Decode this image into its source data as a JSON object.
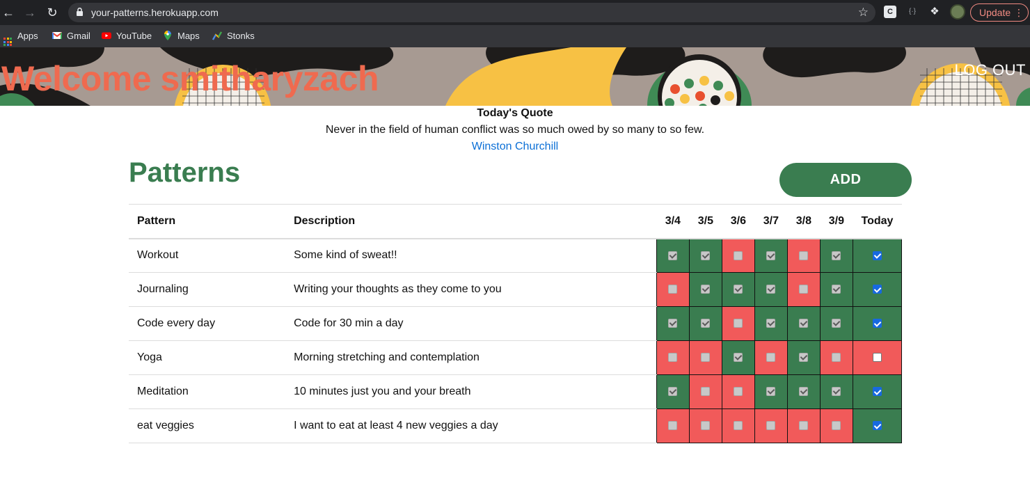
{
  "browser": {
    "url": "your-patterns.herokuapp.com",
    "update_label": "Update",
    "bookmarks": [
      {
        "label": "Apps",
        "icon": "apps-grid-icon"
      },
      {
        "label": "Gmail",
        "icon": "gmail-icon"
      },
      {
        "label": "YouTube",
        "icon": "youtube-icon"
      },
      {
        "label": "Maps",
        "icon": "maps-icon"
      },
      {
        "label": "Stonks",
        "icon": "stonks-icon"
      }
    ]
  },
  "header": {
    "welcome": "Welcome smitharyzach",
    "logout": "LOG OUT"
  },
  "quote": {
    "title": "Today's Quote",
    "text": "Never in the field of human conflict was so much owed by so many to so few.",
    "author": "Winston Churchill"
  },
  "patterns": {
    "title": "Patterns",
    "add_label": "ADD",
    "columns": {
      "pattern": "Pattern",
      "description": "Description",
      "days": [
        "3/4",
        "3/5",
        "3/6",
        "3/7",
        "3/8",
        "3/9"
      ],
      "today": "Today"
    },
    "rows": [
      {
        "name": "Workout",
        "description": "Some kind of sweat!!",
        "days": [
          true,
          true,
          false,
          true,
          false,
          true
        ],
        "today": true
      },
      {
        "name": "Journaling",
        "description": "Writing your thoughts as they come to you",
        "days": [
          false,
          true,
          true,
          true,
          false,
          true
        ],
        "today": true
      },
      {
        "name": "Code every day",
        "description": "Code for 30 min a day",
        "days": [
          true,
          true,
          false,
          true,
          true,
          true
        ],
        "today": true
      },
      {
        "name": "Yoga",
        "description": "Morning stretching and contemplation",
        "days": [
          false,
          false,
          true,
          false,
          true,
          false
        ],
        "today": false
      },
      {
        "name": "Meditation",
        "description": "10 minutes just you and your breath",
        "days": [
          true,
          false,
          false,
          true,
          true,
          true
        ],
        "today": true
      },
      {
        "name": "eat veggies",
        "description": "I want to eat at least 4 new veggies a day",
        "days": [
          false,
          false,
          false,
          false,
          false,
          false
        ],
        "today": true
      }
    ]
  },
  "colors": {
    "done": "#3a7d50",
    "missed": "#f15a5a",
    "brand_green": "#3a7d50",
    "welcome": "#ef6a4f",
    "link": "#0b6fd6"
  }
}
